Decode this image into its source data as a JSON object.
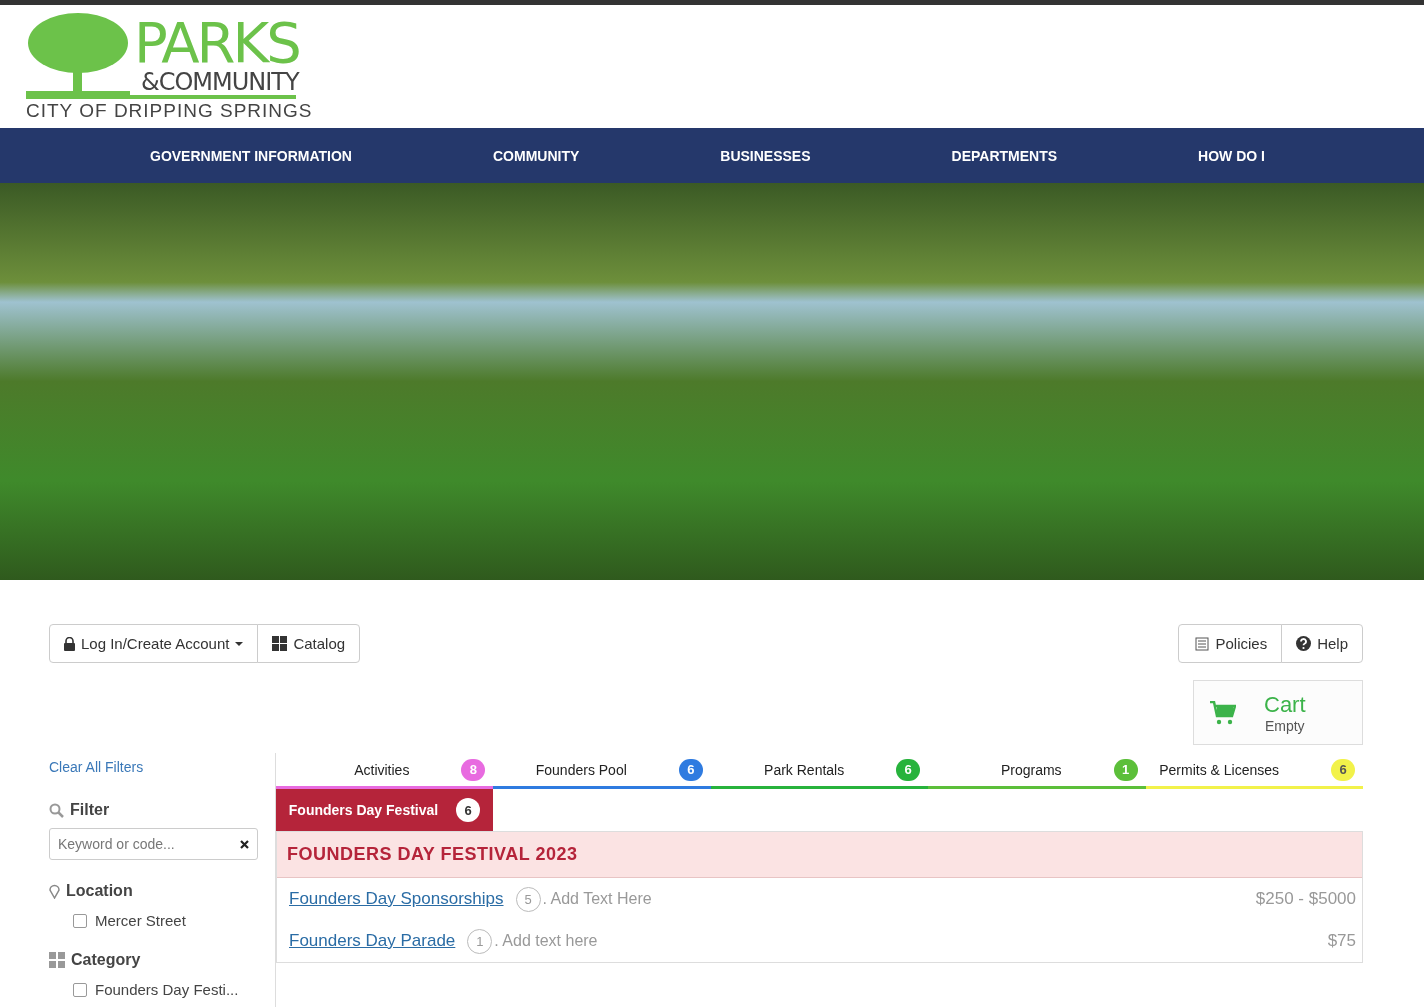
{
  "logo": {
    "title": "PARKS",
    "subtitle": "&COMMUNITY",
    "tagline": "CITY OF DRIPPING SPRINGS"
  },
  "nav": [
    "GOVERNMENT INFORMATION",
    "COMMUNITY",
    "BUSINESSES",
    "DEPARTMENTS",
    "HOW DO I"
  ],
  "toolbar": {
    "left": [
      {
        "kind": "lock",
        "label": "Log In/Create Account",
        "dropdown": true
      },
      {
        "kind": "grid",
        "label": "Catalog",
        "dropdown": false
      }
    ],
    "right": [
      {
        "kind": "policies",
        "label": "Policies"
      },
      {
        "kind": "help",
        "label": "Help"
      }
    ]
  },
  "cart": {
    "title": "Cart",
    "status": "Empty"
  },
  "sidebar": {
    "clear": "Clear All Filters",
    "filter": {
      "title": "Filter",
      "placeholder": "Keyword or code..."
    },
    "groups": [
      {
        "kind": "location",
        "title": "Location",
        "options": [
          {
            "label": "Mercer Street",
            "checked": false
          }
        ]
      },
      {
        "kind": "category",
        "title": "Category",
        "options": [
          {
            "label": "Founders Day Festi...",
            "checked": false
          }
        ]
      }
    ]
  },
  "tabs": [
    {
      "label": "Activities",
      "count": "8",
      "color": "#e86be0"
    },
    {
      "label": "Founders Pool",
      "count": "6",
      "color": "#2f7be0"
    },
    {
      "label": "Park Rentals",
      "count": "6",
      "color": "#27b33c"
    },
    {
      "label": "Programs",
      "count": "1",
      "color": "#5cbf3a"
    },
    {
      "label": "Permits & Licenses",
      "count": "6",
      "color": "#f2f24a"
    }
  ],
  "subtabs": [
    {
      "label": "Founders Day Festival",
      "count": "6",
      "selected": true
    }
  ],
  "section": {
    "title": "FOUNDERS DAY FESTIVAL 2023",
    "items": [
      {
        "name": "Founders Day Sponsorships",
        "count": "5",
        "description": ". Add Text Here",
        "price": "$250 - $5000"
      },
      {
        "name": "Founders Day Parade",
        "count": "1",
        "description": ". Add text here",
        "price": "$75"
      }
    ]
  }
}
